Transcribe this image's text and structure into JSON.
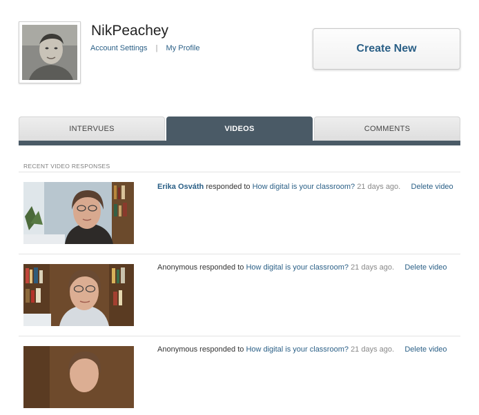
{
  "profile": {
    "username": "NikPeachey",
    "account_settings_label": "Account Settings",
    "separator": "|",
    "my_profile_label": "My Profile"
  },
  "actions": {
    "create_new_label": "Create New"
  },
  "tabs": [
    {
      "label": "INTERVUES",
      "active": false
    },
    {
      "label": "VIDEOS",
      "active": true
    },
    {
      "label": "COMMENTS",
      "active": false
    }
  ],
  "section": {
    "title": "RECENT VIDEO RESPONSES"
  },
  "responses": [
    {
      "responder": "Erika Osváth",
      "verb": "responded to",
      "question": "How digital is your classroom?",
      "time": "21 days ago.",
      "delete_label": "Delete video"
    },
    {
      "responder": "Anonymous",
      "verb": "responded to",
      "question": "How digital is your classroom?",
      "time": "21 days ago.",
      "delete_label": "Delete video"
    },
    {
      "responder": "Anonymous",
      "verb": "responded to",
      "question": "How digital is your classroom?",
      "time": "21 days ago.",
      "delete_label": "Delete video"
    }
  ],
  "colors": {
    "link": "#2a5f86",
    "tab_active": "#4a5a66",
    "tab_inactive": "#e6e6e6"
  }
}
